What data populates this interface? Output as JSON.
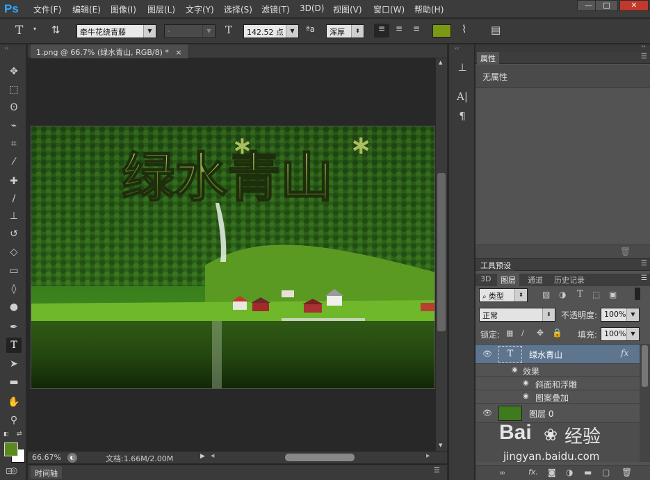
{
  "menubar": {
    "logo": "Ps",
    "items": [
      "文件(F)",
      "编辑(E)",
      "图像(I)",
      "图层(L)",
      "文字(Y)",
      "选择(S)",
      "滤镜(T)",
      "3D(D)",
      "视图(V)",
      "窗口(W)",
      "帮助(H)"
    ],
    "window_buttons": [
      "—",
      "□",
      "✕"
    ]
  },
  "options": {
    "font_family": "牵牛花绕青藤",
    "font_style": "-",
    "font_size": "142.52 点",
    "aa_label": "ªa",
    "antialias": "浑厚",
    "color": "#7a9a14"
  },
  "document": {
    "tab_title": "1.png @ 66.7% (绿水青山, RGB/8) *",
    "close": "×",
    "canvas_text": "绿水青山",
    "zoom": "66.67%",
    "doc_size": "文档:1.66M/2.00M",
    "timeline_tab": "时间轴"
  },
  "properties_panel": {
    "tab": "属性",
    "content": "无属性"
  },
  "tool_presets_panel": {
    "tab": "工具预设"
  },
  "layers_panel": {
    "tabs": [
      "3D",
      "图层",
      "通道",
      "历史记录"
    ],
    "filter_kind": "类型",
    "blend_mode": "正常",
    "opacity_label": "不透明度:",
    "opacity": "100%",
    "lock_label": "锁定:",
    "fill_label": "填充:",
    "fill": "100%",
    "layers": [
      {
        "name": "绿水青山",
        "type": "text",
        "fx": "fx",
        "thumb": "T"
      },
      {
        "name": "图层 0",
        "type": "image"
      }
    ],
    "effects_label": "效果",
    "effects": [
      "斜面和浮雕",
      "图案叠加"
    ]
  },
  "watermark": {
    "brand": "Bai",
    "brand2": "经验",
    "url": "jingyan.baidu.com"
  },
  "colors": {
    "foreground": "#5a8a1e",
    "background": "#ffffff"
  }
}
